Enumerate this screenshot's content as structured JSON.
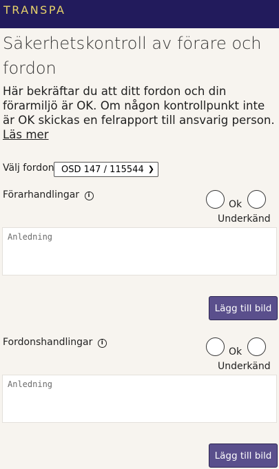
{
  "header": {
    "brand": "TRANSPA"
  },
  "page": {
    "title": "Säkerhetskontroll av förare och fordon",
    "intro": "Här bekräftar du att ditt fordon och din förarmiljö är OK. Om någon kontrollpunkt inte är OK skickas en felrapport till ansvarig person.",
    "read_more": "Läs mer"
  },
  "vehicle": {
    "label": "Välj fordon",
    "selected": "OSD 147 / 115544"
  },
  "checks": [
    {
      "label": "Förarhandlingar",
      "ok_label": "Ok",
      "fail_label": "Underkänd",
      "placeholder": "Anledning",
      "add_image": "Lägg till bild"
    },
    {
      "label": "Fordonshandlingar",
      "ok_label": "Ok",
      "fail_label": "Underkänd",
      "placeholder": "Anledning",
      "add_image": "Lägg till bild"
    }
  ],
  "icons": {
    "info": "info-circle-icon",
    "dropdown": "chevron-down-icon"
  },
  "colors": {
    "header_bg": "#221b5c",
    "brand": "#e8d36a",
    "button_bg": "#5a4f8c"
  }
}
